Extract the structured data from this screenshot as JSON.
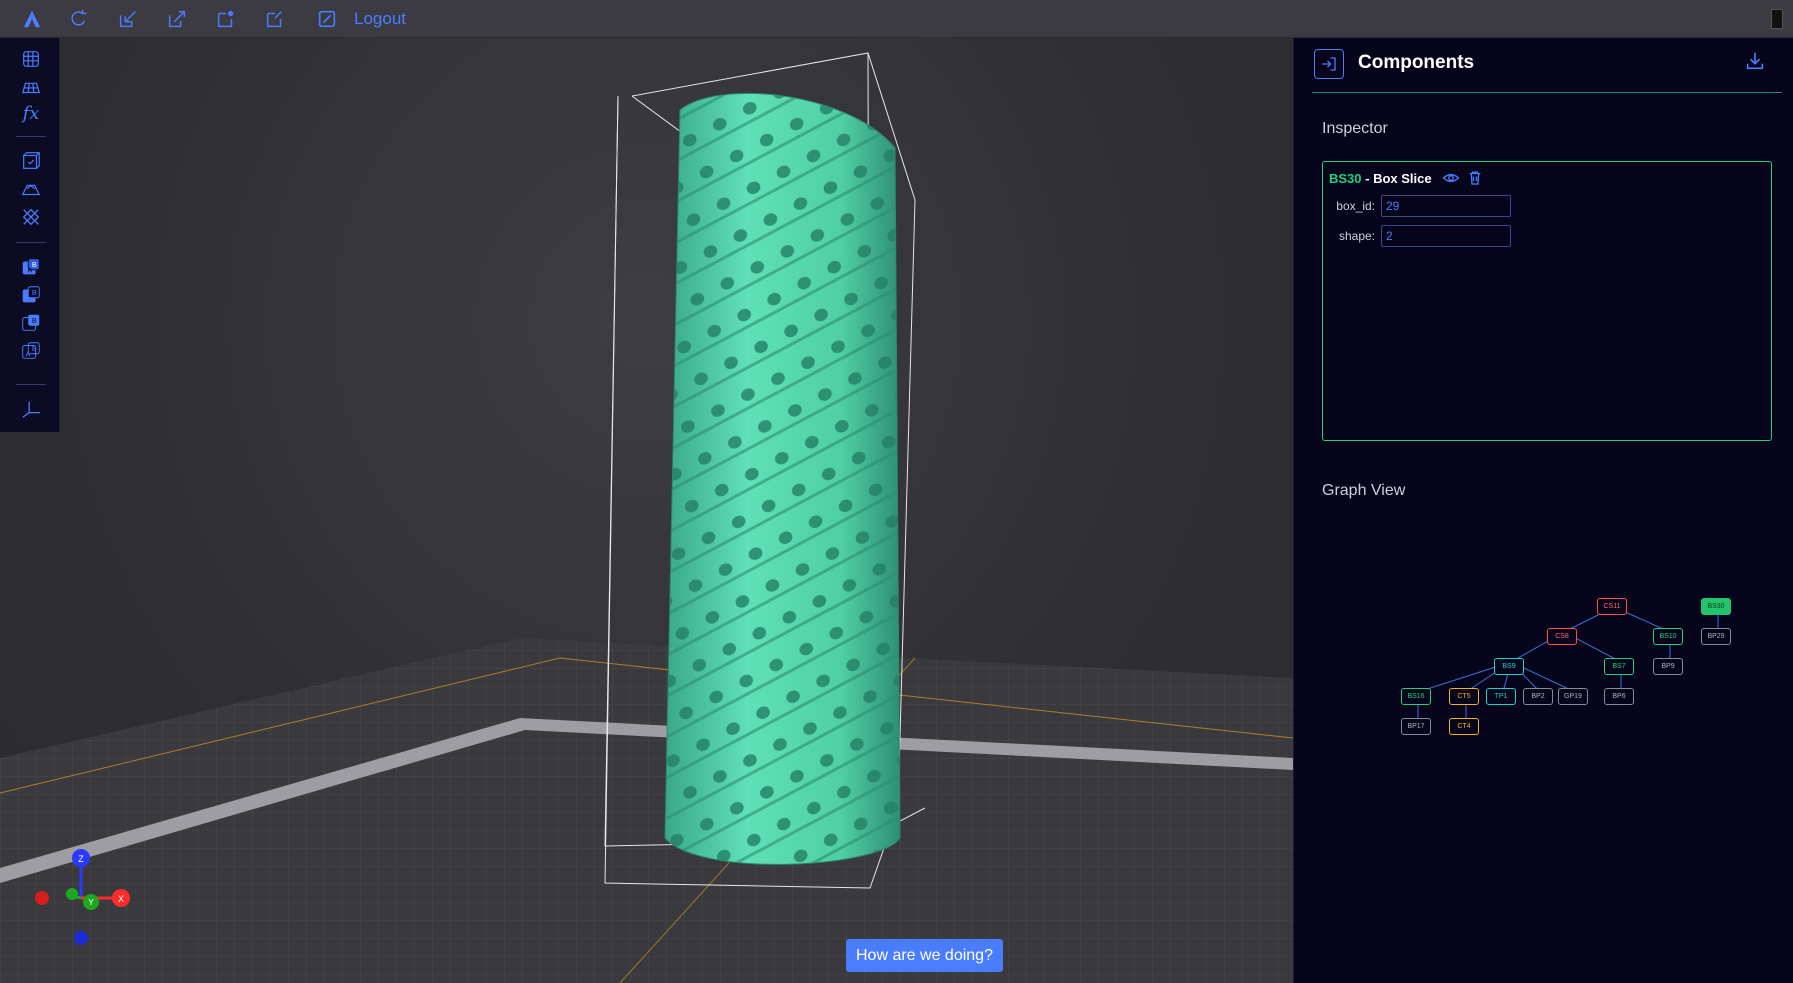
{
  "topbar": {
    "icons": [
      "app-logo-icon",
      "redo-icon",
      "import-icon",
      "export-icon",
      "new-project-icon",
      "edit-project-icon",
      "logout-icon"
    ],
    "logout_label": "Logout"
  },
  "left_toolbar": {
    "fx_label": "fx",
    "icons": [
      "lattice-icon",
      "grid-plane-icon",
      "function-icon",
      "box-icon",
      "surface-icon",
      "pattern-icon",
      "boolean-a-b-icon",
      "boolean-b-icon",
      "boolean-ab-icon",
      "boolean-ab-alt-icon",
      "axis-icon"
    ]
  },
  "panel": {
    "title": "Components",
    "inspector": {
      "section_title": "Inspector",
      "component_id": "BS30",
      "component_name": " - Box Slice",
      "fields": [
        {
          "label": "box_id:",
          "value": "29"
        },
        {
          "label": "shape:",
          "value": "2"
        }
      ]
    },
    "graph_view": {
      "section_title": "Graph View",
      "nodes": [
        {
          "id": "CS11",
          "color": "red"
        },
        {
          "id": "BS30",
          "color": "filled"
        },
        {
          "id": "CS8",
          "color": "red"
        },
        {
          "id": "BS10",
          "color": "green"
        },
        {
          "id": "BP29",
          "color": "gray"
        },
        {
          "id": "BS9",
          "color": "teal"
        },
        {
          "id": "BS7",
          "color": "green"
        },
        {
          "id": "BP9",
          "color": "gray"
        },
        {
          "id": "BS16",
          "color": "green"
        },
        {
          "id": "CT5",
          "color": "yellow"
        },
        {
          "id": "TP1",
          "color": "teal"
        },
        {
          "id": "BP2",
          "color": "gray"
        },
        {
          "id": "GP19",
          "color": "gray"
        },
        {
          "id": "BP6",
          "color": "gray"
        },
        {
          "id": "BP17",
          "color": "gray"
        },
        {
          "id": "CT4",
          "color": "yellow"
        }
      ]
    }
  },
  "viewport": {
    "axis_labels": [
      "Z",
      "X",
      "Y"
    ],
    "model_color": "#4fd1a5"
  },
  "feedback": {
    "label": "How are we doing?"
  },
  "colors": {
    "accent": "#4a7cff",
    "success": "#21d07a",
    "danger": "#ff4b4b",
    "warning": "#f6b21b",
    "teal": "#1fd2c9"
  }
}
